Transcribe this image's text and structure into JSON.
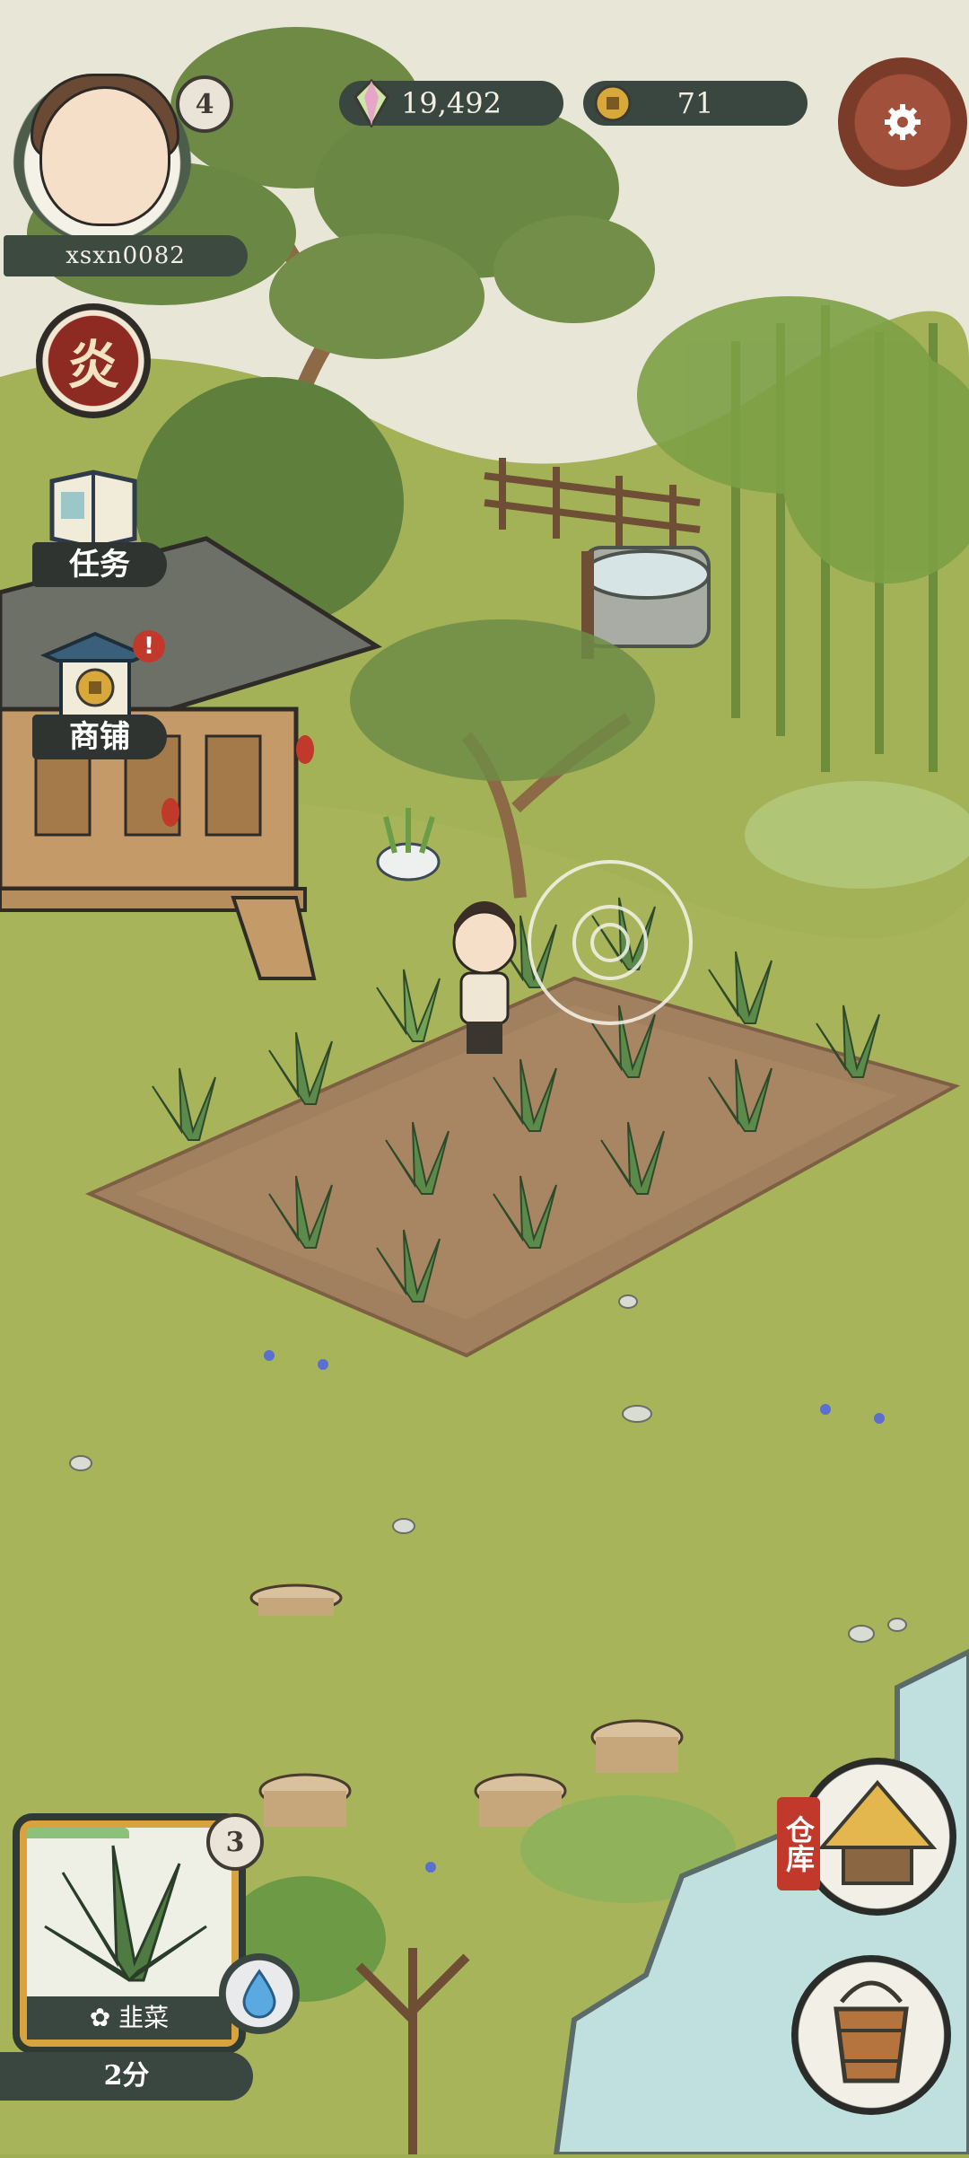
{
  "player": {
    "name": "xsxn0082",
    "level": "4"
  },
  "resources": {
    "gems": "19,492",
    "coins": "71"
  },
  "hud": {
    "fire_button_label": "炎",
    "tasks_label": "任务",
    "shop_label": "商铺",
    "shop_alert": "!"
  },
  "crop": {
    "name": "韭菜",
    "seed_count": "3",
    "time_remaining": "2分",
    "growth_progress": 0.5
  },
  "buildings": {
    "warehouse_label": "仓库"
  },
  "icons": {
    "gem": "crystal-gem-icon",
    "coin": "copper-coin-icon",
    "settings": "gear-icon",
    "tasks": "scroll-book-icon",
    "shop": "pavilion-coin-icon",
    "water": "water-drop-icon",
    "warehouse": "straw-hut-icon",
    "bucket": "wooden-bucket-icon"
  },
  "colors": {
    "grass": "#9fae52",
    "soil": "#a1805f",
    "hud_dark": "#3a4640",
    "accent_red": "#c0392b",
    "accent_gold": "#d8a23e",
    "accent_teal": "#3ab3b2"
  }
}
